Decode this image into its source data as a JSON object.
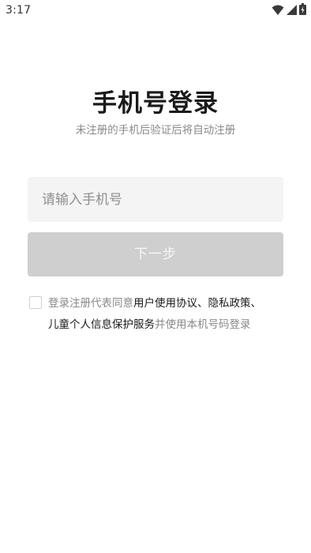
{
  "status_bar": {
    "time": "3:17",
    "icons": [
      "wifi-icon",
      "cellular-signal-icon",
      "battery-icon"
    ]
  },
  "title": "手机号登录",
  "subtitle": "未注册的手机后验证后将自动注册",
  "phone_input": {
    "placeholder": "请输入手机号",
    "value": ""
  },
  "next_button_label": "下一步",
  "agreement": {
    "prefix": "登录注册代表同意",
    "user_agreement": "用户使用协议",
    "sep1": "、",
    "privacy_policy": "隐私政策",
    "sep2": "、",
    "children_privacy": "儿童个人信息保护服务",
    "suffix": "并使用本机号码登录",
    "checked": false
  },
  "colors": {
    "background": "#ffffff",
    "input_background": "#f4f4f4",
    "button_disabled": "#cfcfcf",
    "muted_text": "#8a8a8a",
    "title_text": "#1a1a1a"
  }
}
